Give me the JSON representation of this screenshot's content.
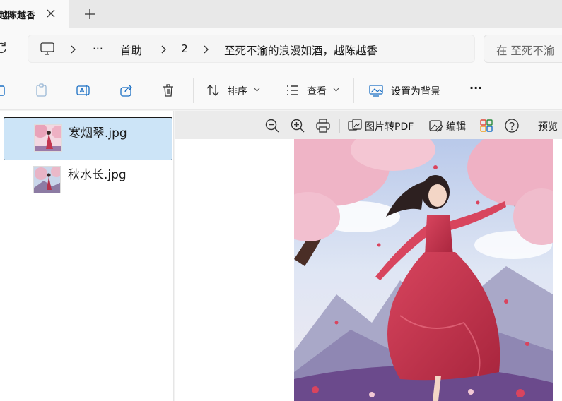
{
  "tab": {
    "title": "越陈越香"
  },
  "address": {
    "ellipsis": "···",
    "crumbs": [
      "首助",
      "2",
      "至死不渝的浪漫如酒，越陈越香"
    ],
    "search_placeholder": "在 至死不渝"
  },
  "commands": {
    "sort_label": "排序",
    "view_label": "查看",
    "set_background_label": "设置为背景",
    "more_label": "···"
  },
  "files": [
    {
      "name": "寒烟翠.jpg",
      "selected": true
    },
    {
      "name": "秋水长.jpg",
      "selected": false
    }
  ],
  "preview_toolbar": {
    "to_pdf_label": "图片转PDF",
    "edit_label": "编辑",
    "preview_label": "预览"
  },
  "colors": {
    "selection": "#cce4f7",
    "accent": "#1a6fc4"
  }
}
